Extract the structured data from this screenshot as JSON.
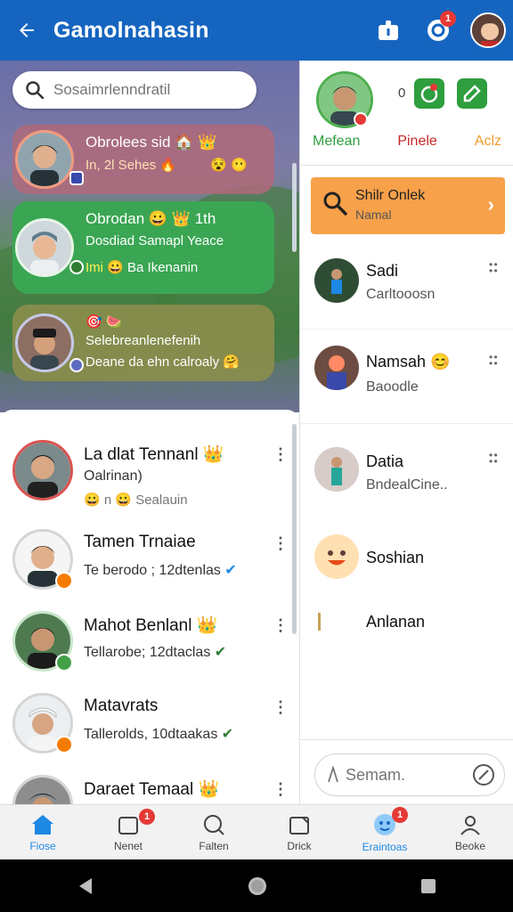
{
  "appbar": {
    "title": "Gamolnahasin",
    "notification_count": "1"
  },
  "search": {
    "placeholder": "Sosaimrlenndratil"
  },
  "game_cards": [
    {
      "line1": "Obrolees sid",
      "line2": "In, 2l Sehes",
      "color": "#b06a7a"
    },
    {
      "line1": "Obrodan",
      "line1b": "1th",
      "line2": "Dosdiad Samapl Yeace",
      "line3": "Imi",
      "line3b": "Ba Ikenanin",
      "color": "#3aa653"
    },
    {
      "line1": "Selebreanlenefenih",
      "line2": "Deane da ehn calroaly",
      "color": "#8a8d4c"
    }
  ],
  "list": [
    {
      "name": "La dlat Tennanl",
      "sub": "Oalrinan)",
      "sub2": "Sealauin"
    },
    {
      "name": "Tamen Trnaiae",
      "sub": "Te berodo ; 12dtenlas"
    },
    {
      "name": "Mahot Benlanl",
      "sub": "Tellarobe; 12dtaclas"
    },
    {
      "name": "Matavrats",
      "sub": "Tallerolds, 10dtaakas"
    },
    {
      "name": "Daraet Temaal",
      "sub": ""
    }
  ],
  "right_panel": {
    "top_count": "0",
    "tabs": [
      "Mefean",
      "Pinele",
      "Aclz"
    ],
    "orange_card": {
      "title": "Shilr Onlek",
      "subtitle": "Namal"
    },
    "contacts": [
      {
        "name": "Sadi",
        "sub": "Carltooosn"
      },
      {
        "name": "Namsah",
        "sub": "Baoodle"
      },
      {
        "name": "Datia",
        "sub": "BndealCine.."
      },
      {
        "name": "Soshian",
        "sub": ""
      },
      {
        "name": "Anlanan",
        "sub": ""
      }
    ],
    "message_placeholder": "Semam."
  },
  "bottom_nav": [
    {
      "label": "Fiose",
      "active": true
    },
    {
      "label": "Nenet",
      "badge": "1"
    },
    {
      "label": "Falten"
    },
    {
      "label": "Drick"
    },
    {
      "label": "Eraintoas",
      "badge": "1"
    },
    {
      "label": "Beoke"
    }
  ],
  "colors": {
    "primary": "#1565c0",
    "accent_green": "#3aa653",
    "accent_orange": "#f7a14a",
    "active_nav": "#1e88e5"
  }
}
